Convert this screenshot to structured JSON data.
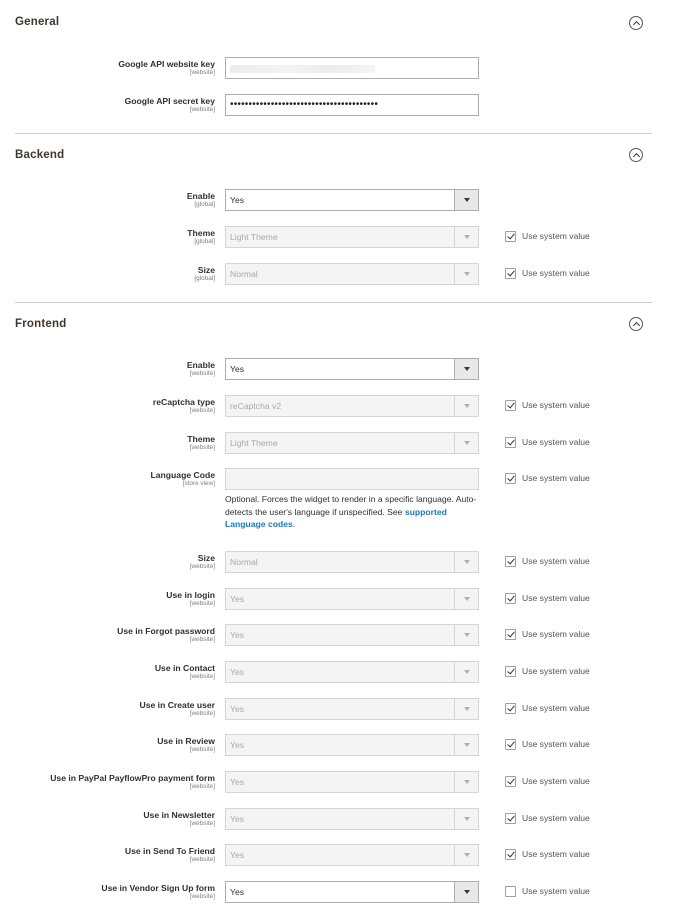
{
  "sections": {
    "general": {
      "title": "General"
    },
    "backend": {
      "title": "Backend"
    },
    "frontend": {
      "title": "Frontend"
    }
  },
  "system_value_label": "Use system value",
  "general": {
    "api_key": {
      "label": "Google API website key",
      "scope": "[website]",
      "value": ""
    },
    "api_secret": {
      "label": "Google API secret key",
      "scope": "[website]",
      "value": "••••••••••••••••••••••••••••••••••••••••"
    }
  },
  "backend": {
    "enable": {
      "label": "Enable",
      "scope": "[global]",
      "value": "Yes"
    },
    "theme": {
      "label": "Theme",
      "scope": "[global]",
      "value": "Light Theme",
      "use_system": true
    },
    "size": {
      "label": "Size",
      "scope": "[global]",
      "value": "Normal",
      "use_system": true
    }
  },
  "frontend": {
    "enable": {
      "label": "Enable",
      "scope": "[website]",
      "value": "Yes"
    },
    "type": {
      "label": "reCaptcha type",
      "scope": "[website]",
      "value": "reCaptcha v2",
      "use_system": true
    },
    "theme": {
      "label": "Theme",
      "scope": "[website]",
      "value": "Light Theme",
      "use_system": true
    },
    "language": {
      "label": "Language Code",
      "scope": "[store view]",
      "value": "",
      "use_system": true,
      "note": "Optional. Forces the widget to render in a specific language. Auto-detects the user's language if unspecified. See ",
      "note_link": "supported Language codes",
      "note_end": "."
    },
    "size": {
      "label": "Size",
      "scope": "[website]",
      "value": "Normal",
      "use_system": true
    },
    "login": {
      "label": "Use in login",
      "scope": "[website]",
      "value": "Yes",
      "use_system": true
    },
    "forgot": {
      "label": "Use in Forgot password",
      "scope": "[website]",
      "value": "Yes",
      "use_system": true
    },
    "contact": {
      "label": "Use in Contact",
      "scope": "[website]",
      "value": "Yes",
      "use_system": true
    },
    "create_user": {
      "label": "Use in Create user",
      "scope": "[website]",
      "value": "Yes",
      "use_system": true
    },
    "review": {
      "label": "Use in Review",
      "scope": "[website]",
      "value": "Yes",
      "use_system": true
    },
    "paypal": {
      "label": "Use in PayPal PayflowPro payment form",
      "scope": "[website]",
      "value": "Yes",
      "use_system": true
    },
    "newsletter": {
      "label": "Use in Newsletter",
      "scope": "[website]",
      "value": "Yes",
      "use_system": true
    },
    "send_friend": {
      "label": "Use in Send To Friend",
      "scope": "[website]",
      "value": "Yes",
      "use_system": true
    },
    "vendor_signup": {
      "label": "Use in Vendor Sign Up form",
      "scope": "[website]",
      "value": "Yes",
      "use_system": false
    }
  }
}
